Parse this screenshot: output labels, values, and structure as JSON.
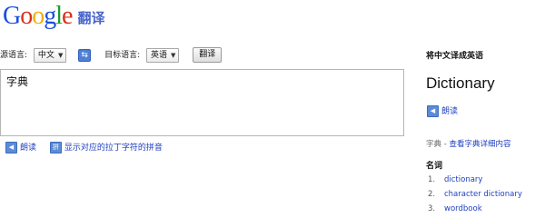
{
  "logo": {
    "letters": [
      "G",
      "o",
      "o",
      "g",
      "l",
      "e"
    ],
    "suffix": "翻译"
  },
  "toolbar": {
    "source_label": "源语言:",
    "source_value": "中文",
    "target_label": "目标语言:",
    "target_value": "英语",
    "translate_button": "翻译",
    "swap_icon": "swap-arrows-icon"
  },
  "source": {
    "text": "字典"
  },
  "helper": {
    "listen_label": "朗读",
    "phonetic_label": "显示对应的拉丁字符的拼音",
    "speaker_icon": "speaker-icon",
    "pinyin_icon": "pinyin-icon"
  },
  "result": {
    "heading": "将中文译成英语",
    "translation": "Dictionary",
    "listen_label": "朗读",
    "dict_word": "字典",
    "dict_sep": " - ",
    "dict_link": "查看字典详细内容",
    "pos": "名词",
    "entries": [
      {
        "num": "1.",
        "word": "dictionary"
      },
      {
        "num": "2.",
        "word": "character dictionary"
      },
      {
        "num": "3.",
        "word": "wordbook"
      }
    ]
  }
}
